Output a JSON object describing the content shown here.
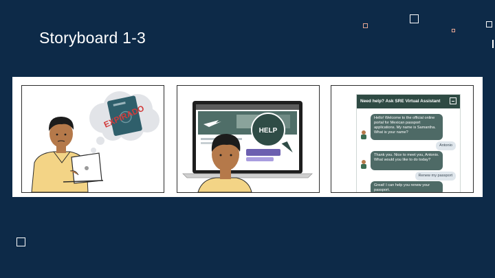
{
  "title": "Storyboard 1-3",
  "panels": {
    "p1": {
      "stamp": "EXPIRADO"
    },
    "p2": {
      "bubble": "HELP"
    },
    "p3": {
      "header": "Need help? Ask SRE Virtual Assistant",
      "messages": [
        {
          "from": "bot",
          "text": "Hello! Welcome to the official online portal for Mexican passport applications. My name is Samantha. What is your name?"
        },
        {
          "from": "user",
          "text": "Antonio"
        },
        {
          "from": "bot",
          "text": "Thank you. Nice to meet you, Antonio. What would you like to do today?"
        },
        {
          "from": "user",
          "text": "Renew my passport"
        },
        {
          "from": "bot",
          "text": "Great! I can help you renew your passport."
        }
      ]
    }
  },
  "colors": {
    "background": "#0d2a48",
    "accent_square": "#e8a894",
    "chat_header": "#2e4a43",
    "bot_bubble": "#4e6a66",
    "user_bubble": "#dfe6ec",
    "shirt": "#f3d486",
    "skin": "#b5794a",
    "stamp": "#d23a3a"
  }
}
